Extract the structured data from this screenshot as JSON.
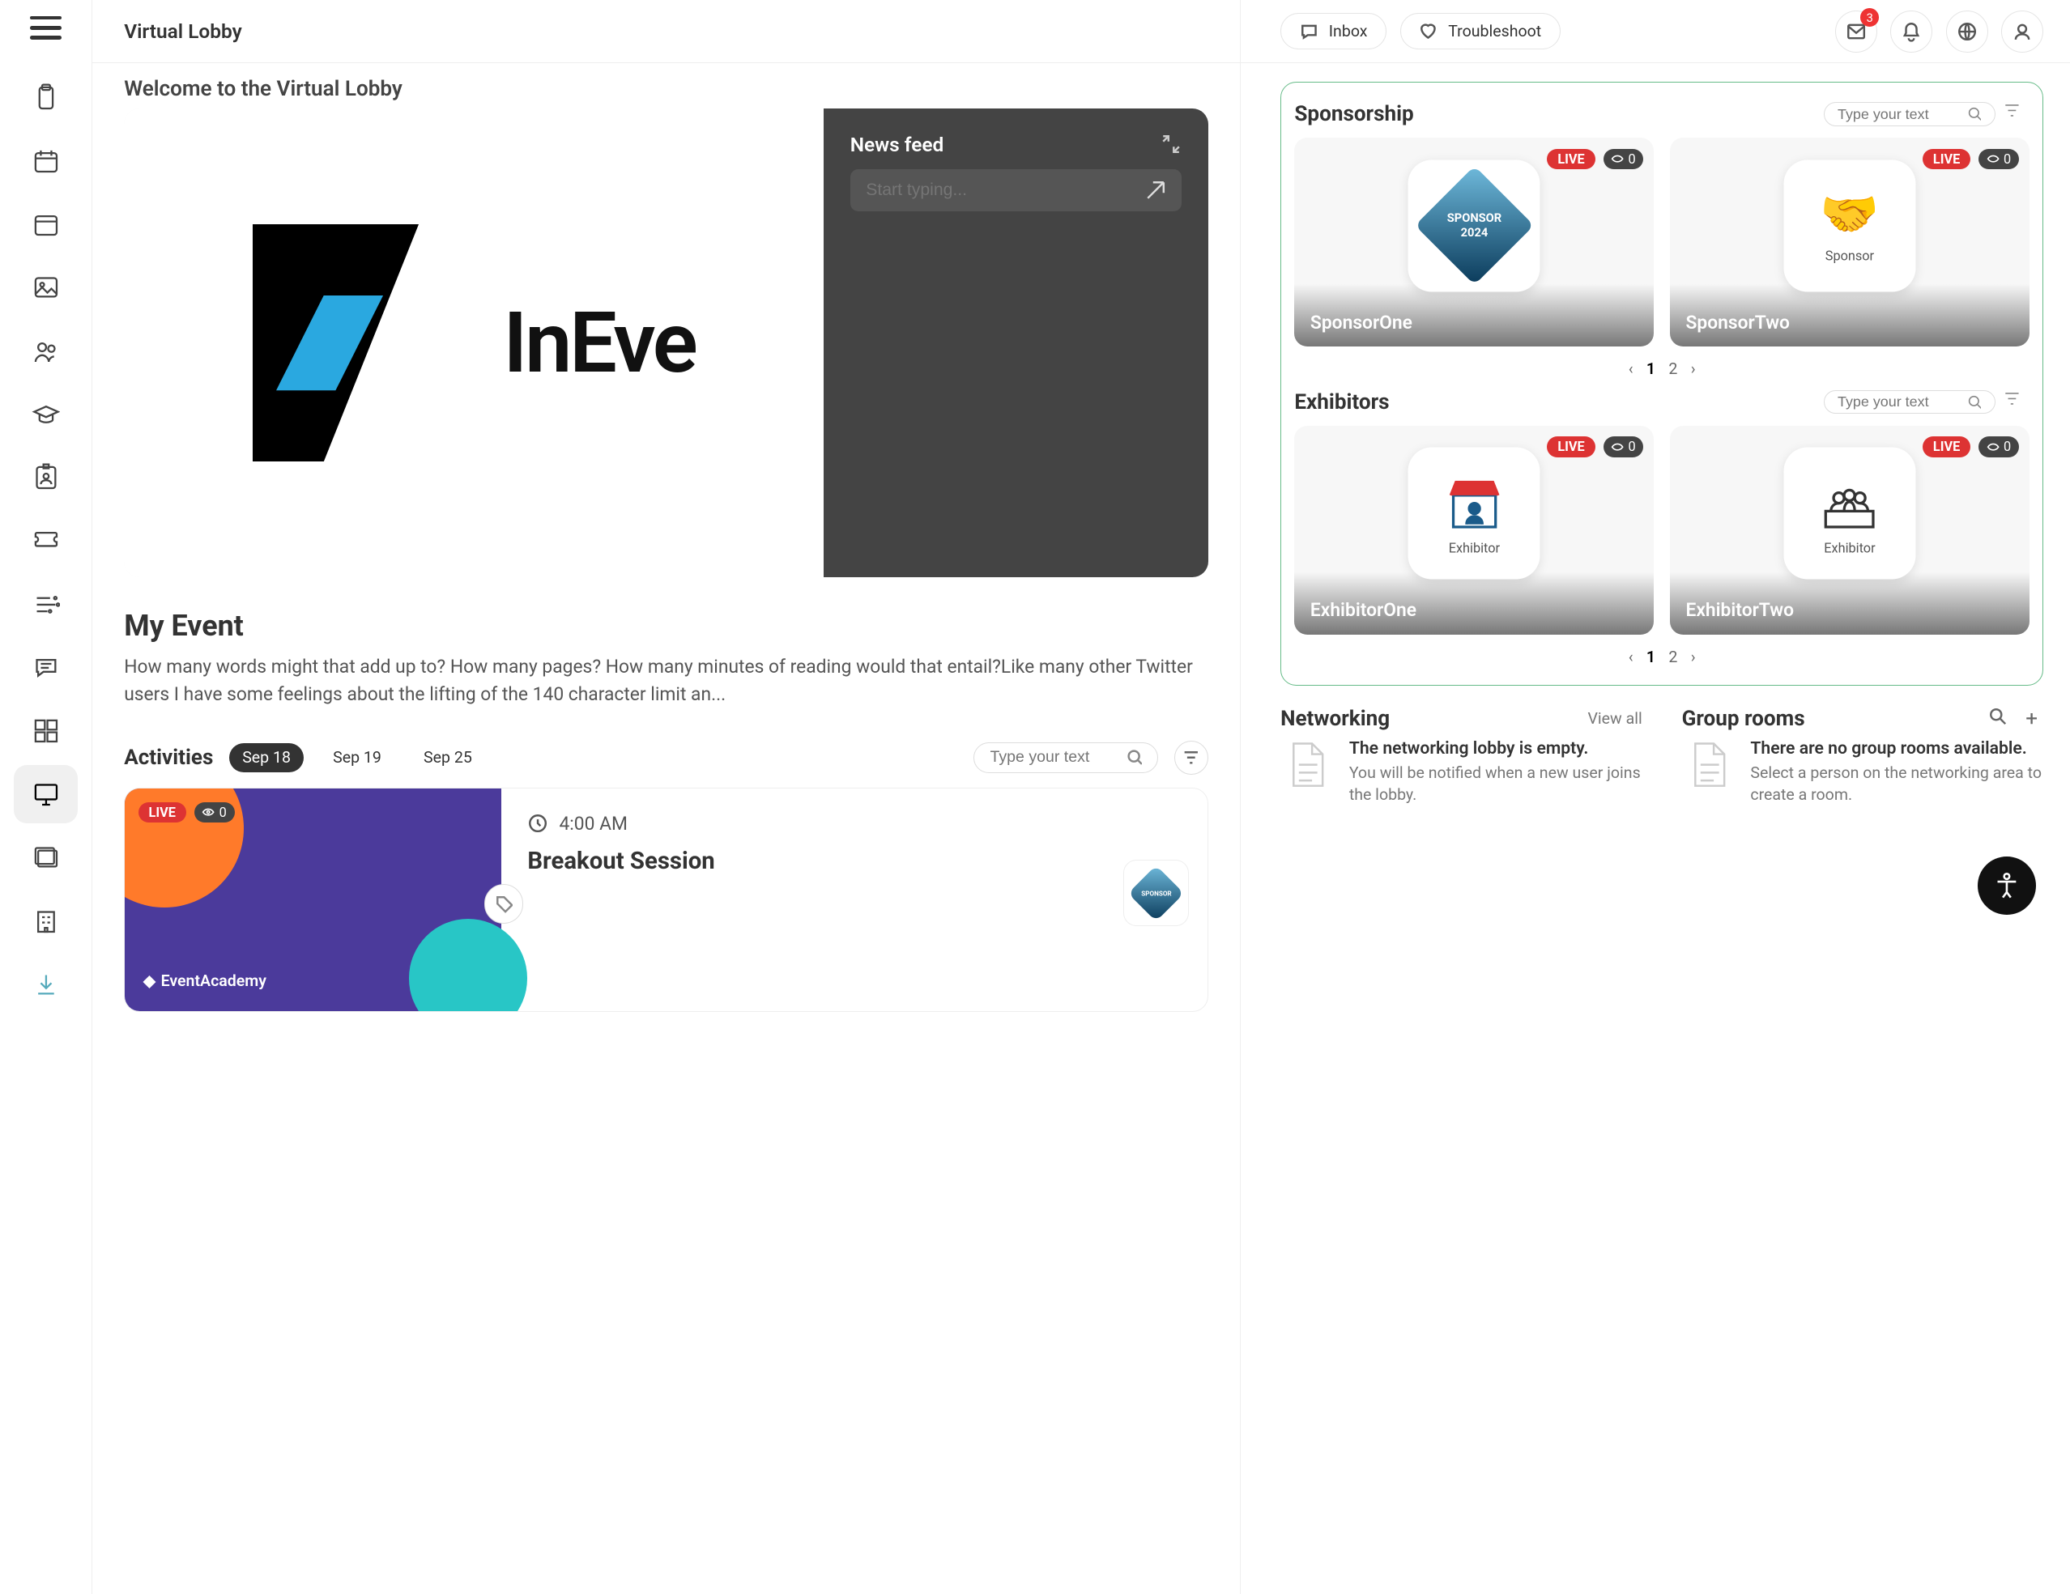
{
  "header": {
    "title": "Virtual Lobby",
    "inbox_label": "Inbox",
    "troubleshoot_label": "Troubleshoot",
    "notification_badge": "3"
  },
  "welcome": {
    "heading": "Welcome to the Virtual Lobby"
  },
  "hero": {
    "logo_text": "InEve",
    "news_feed_title": "News feed",
    "news_feed_placeholder": "Start typing..."
  },
  "my_event": {
    "title": "My Event",
    "description": "How many words might that add up to? How many pages? How many minutes of reading would that entail?Like many other Twitter users I have some feelings about the lifting of the 140 character limit an..."
  },
  "activities": {
    "title": "Activities",
    "dates": [
      {
        "label": "Sep 18",
        "selected": true
      },
      {
        "label": "Sep 19",
        "selected": false
      },
      {
        "label": "Sep 25",
        "selected": false
      }
    ],
    "search_placeholder": "Type your text",
    "items": [
      {
        "live": "LIVE",
        "viewers": "0",
        "time": "4:00 AM",
        "title": "Breakout Session",
        "thumb_brand": "EventAcademy"
      }
    ]
  },
  "sponsorship": {
    "title": "Sponsorship",
    "search_placeholder": "Type your text",
    "cards": [
      {
        "name": "SponsorOne",
        "live": "LIVE",
        "viewers": "0",
        "tile_label": "SPONSOR",
        "tile_year": "2024"
      },
      {
        "name": "SponsorTwo",
        "live": "LIVE",
        "viewers": "0",
        "tile_label": "Sponsor"
      }
    ],
    "pager": {
      "current": "1",
      "other": "2"
    }
  },
  "exhibitors": {
    "title": "Exhibitors",
    "search_placeholder": "Type your text",
    "cards": [
      {
        "name": "ExhibitorOne",
        "live": "LIVE",
        "viewers": "0",
        "tile_label": "Exhibitor"
      },
      {
        "name": "ExhibitorTwo",
        "live": "LIVE",
        "viewers": "0",
        "tile_label": "Exhibitor"
      }
    ],
    "pager": {
      "current": "1",
      "other": "2"
    }
  },
  "networking": {
    "title": "Networking",
    "view_all": "View all",
    "empty_title": "The networking lobby is empty.",
    "empty_body": "You will be notified when a new user joins the lobby."
  },
  "group_rooms": {
    "title": "Group rooms",
    "empty_title": "There are no group rooms available.",
    "empty_body": "Select a person on the networking area to create a room."
  }
}
